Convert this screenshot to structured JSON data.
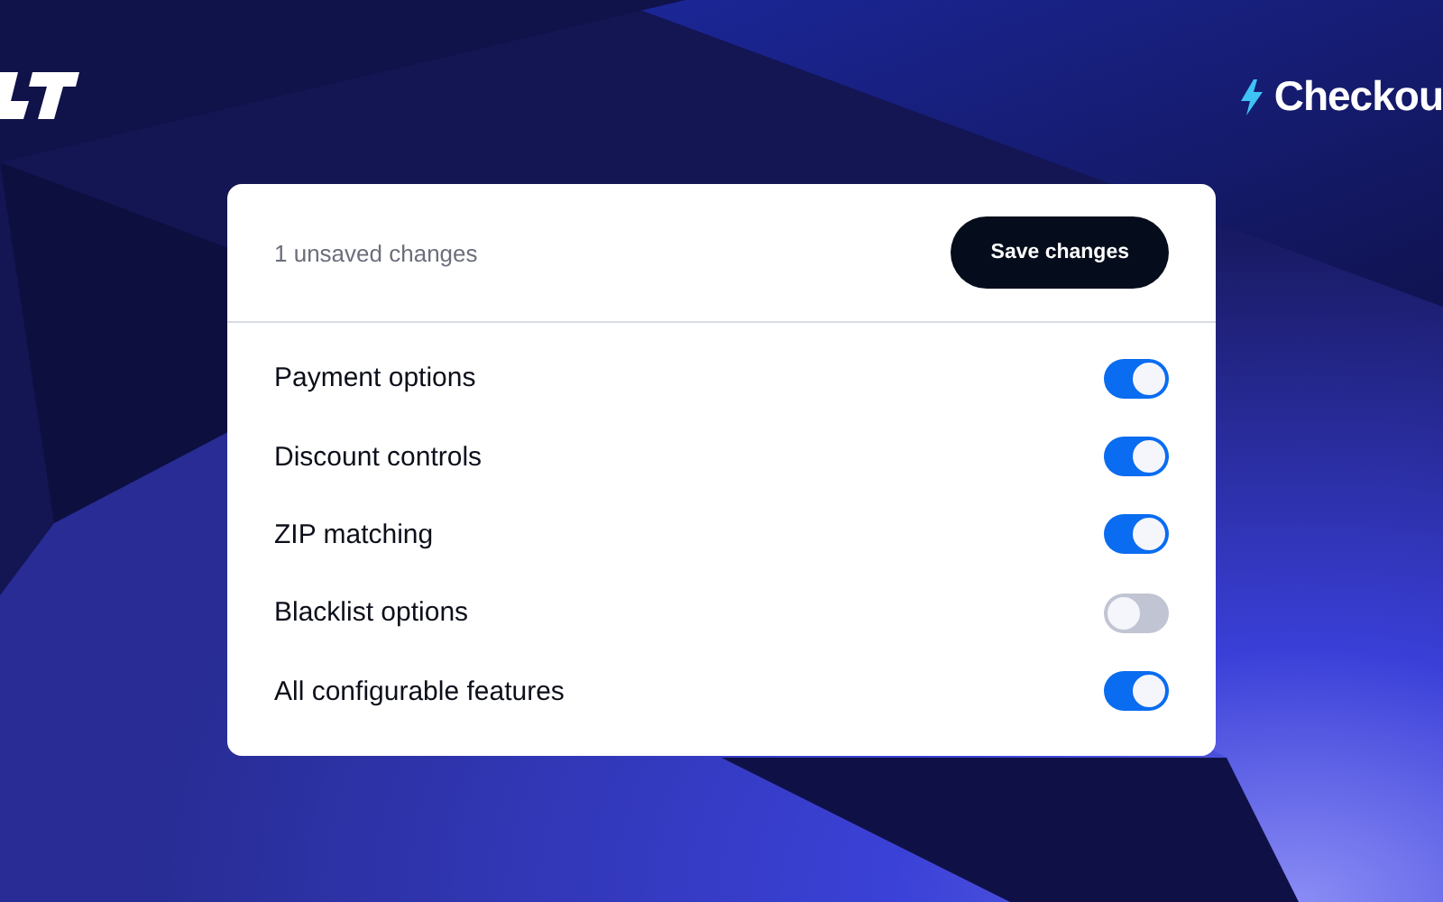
{
  "brand": {
    "name": "Checkou"
  },
  "card": {
    "status": "1 unsaved changes",
    "save_button": "Save changes",
    "settings": [
      {
        "label": "Payment options",
        "on": true
      },
      {
        "label": "Discount controls",
        "on": true
      },
      {
        "label": "ZIP matching",
        "on": true
      },
      {
        "label": "Blacklist options",
        "on": false
      },
      {
        "label": "All configurable features",
        "on": true
      }
    ]
  }
}
